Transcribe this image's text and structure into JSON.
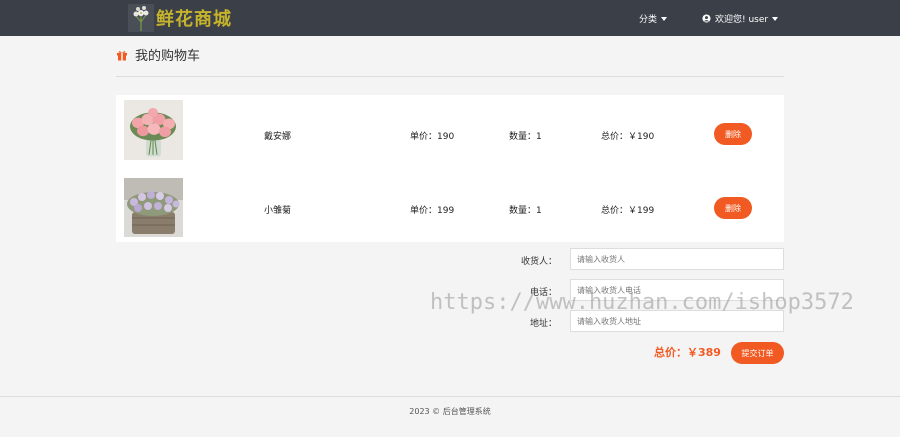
{
  "nav": {
    "brand": "鲜花商城",
    "category": "分类",
    "user": "欢迎您! user"
  },
  "page": {
    "title": "我的购物车"
  },
  "cart": {
    "items": [
      {
        "name": "戴安娜",
        "price": "单价：190",
        "qty": "数量：1",
        "total": "总价：￥190",
        "delete": "删除",
        "image": "pink-roses"
      },
      {
        "name": "小雏菊",
        "price": "单价：199",
        "qty": "数量：1",
        "total": "总价：￥199",
        "delete": "删除",
        "image": "purple-daisies"
      }
    ]
  },
  "form": {
    "receiver_label": "收货人：",
    "receiver_placeholder": "请输入收货人",
    "phone_label": "电话：",
    "phone_placeholder": "请输入收货人电话",
    "address_label": "地址：",
    "address_placeholder": "请输入收货人地址"
  },
  "summary": {
    "total": "总价：￥389",
    "submit": "提交订单"
  },
  "footer": {
    "text": "2023 ©  后台管理系统"
  },
  "watermark": "https://www.huzhan.com/ishop3572",
  "colors": {
    "accent": "#f15a22",
    "navbar": "#3b3f48",
    "brand": "#c6b32c"
  }
}
